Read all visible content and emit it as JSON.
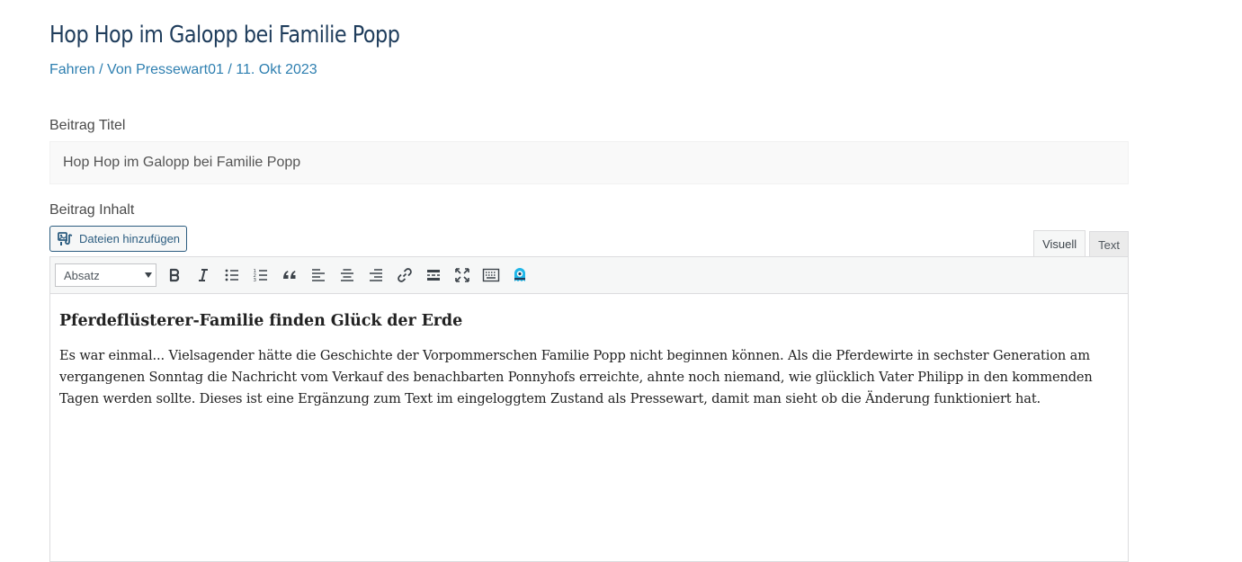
{
  "post": {
    "title": "Hop Hop im Galopp bei Familie Popp",
    "meta": {
      "category": "Fahren",
      "separator1": " / Von ",
      "author": "Pressewart01",
      "separator2": " / ",
      "date": "11. Okt 2023"
    }
  },
  "form": {
    "title_label": "Beitrag Titel",
    "title_value": "Hop Hop im Galopp bei Familie Popp",
    "content_label": "Beitrag Inhalt",
    "add_media_label": "Dateien hinzufügen",
    "tabs": [
      {
        "label": "Visuell",
        "active": true
      },
      {
        "label": "Text",
        "active": false
      }
    ]
  },
  "toolbar": {
    "format_value": "Absatz",
    "buttons": [
      "bold-icon",
      "italic-icon",
      "bullet-list-icon",
      "numbered-list-icon",
      "blockquote-icon",
      "align-left-icon",
      "align-center-icon",
      "align-right-icon",
      "link-icon",
      "read-more-icon",
      "fullscreen-icon",
      "keyboard-icon",
      "ghost-icon"
    ]
  },
  "content": {
    "heading": "Pferdeflüsterer-Familie finden Glück der Erde",
    "paragraph": "Es war einmal... Vielsagender hätte die Geschichte der Vorpommerschen Familie Popp nicht beginnen können. Als die Pferdewirte in sechster Generation am vergangenen Sonntag die Nachricht vom Verkauf des benachbarten Ponnyhofs erreichte, ahnte noch niemand, wie glücklich Vater Philipp in den kommenden Tagen werden sollte. Dieses ist eine Ergänzung zum Text im eingeloggtem Zustand als Pressewart, damit man sieht ob die Änderung funktioniert hat."
  },
  "colors": {
    "title": "#1f3d5c",
    "meta_link": "#2e7fb0",
    "accent_ghost": "#1fb6e8"
  }
}
